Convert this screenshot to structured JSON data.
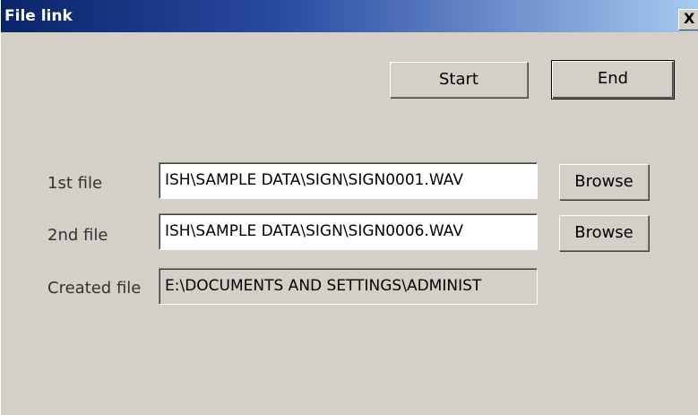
{
  "window": {
    "title": "File link",
    "close_glyph": "X"
  },
  "buttons": {
    "start": "Start",
    "end": "End",
    "browse_1": "Browse",
    "browse_2": "Browse"
  },
  "fields": {
    "first": {
      "label": "1st file",
      "value": "ISH\\SAMPLE DATA\\SIGN\\SIGN0001.WAV"
    },
    "second": {
      "label": "2nd file",
      "value": "ISH\\SAMPLE DATA\\SIGN\\SIGN0006.WAV"
    },
    "created": {
      "label": "Created file",
      "value": "E:\\DOCUMENTS AND SETTINGS\\ADMINIST"
    }
  },
  "colors": {
    "titlebar_start": "#0a246a",
    "titlebar_end": "#a6caf0",
    "face": "#d4d0c8"
  }
}
